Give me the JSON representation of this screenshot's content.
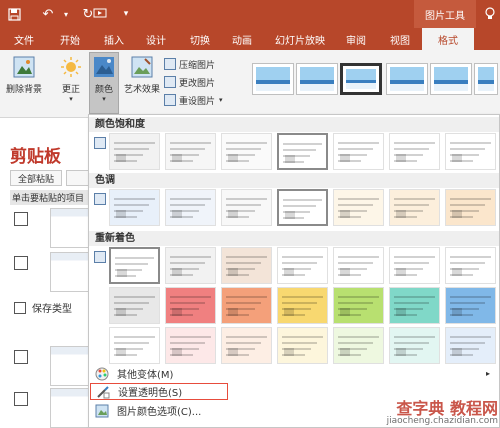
{
  "titlebar": {
    "icons": [
      "save-icon",
      "undo-icon",
      "redo-icon",
      "customize-icon"
    ],
    "context_label": "图片工具",
    "help_icon": "lightbulb-icon"
  },
  "tabs": [
    "文件",
    "开始",
    "插入",
    "设计",
    "切换",
    "动画",
    "幻灯片放映",
    "审阅",
    "视图",
    "格式"
  ],
  "active_tab": "格式",
  "ribbon": {
    "remove_bg": "删除背景",
    "corrections": "更正",
    "color": "颜色",
    "artistic": "艺术效果",
    "compress": "压缩图片",
    "change": "更改图片",
    "reset": "重设图片"
  },
  "pane": {
    "title": "剪贴板",
    "paste_all": "全部粘贴",
    "hint": "单击要粘贴的项目",
    "save_type": "保存类型"
  },
  "menu": {
    "saturation": "颜色饱和度",
    "tone": "色调",
    "recolor": "重新着色",
    "more_variations": "其他变体(M)",
    "set_transparent": "设置透明色(S)",
    "color_options": "图片颜色选项(C)..."
  },
  "colors": {
    "brand": "#b7472a",
    "recolor_row2": [
      "#e8e8e8",
      "#f08080",
      "#f4a07a",
      "#f8d870",
      "#b8e070",
      "#80d8c8",
      "#80b8e8",
      "#c8a0d8"
    ]
  },
  "watermark": {
    "text": "查字典 教程网",
    "url": "jiaocheng.chazidian.com"
  }
}
